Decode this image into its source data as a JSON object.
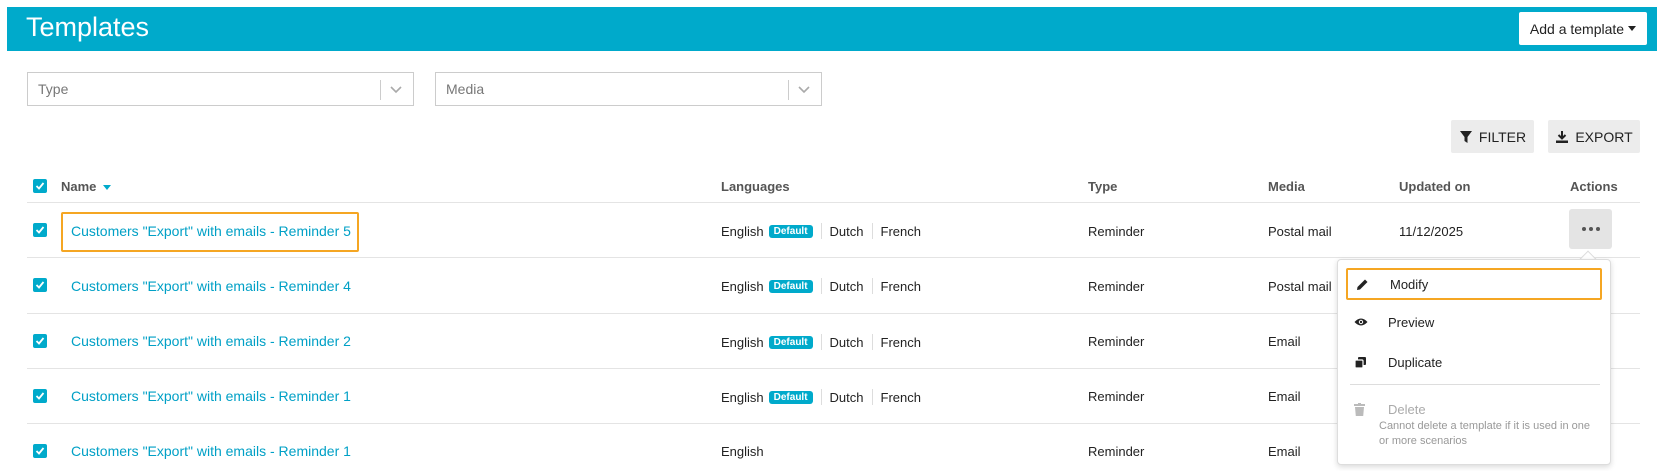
{
  "header": {
    "title": "Templates",
    "add_button": "Add a template"
  },
  "filters": {
    "type_placeholder": "Type",
    "media_placeholder": "Media"
  },
  "toolbar": {
    "filter_label": "FILTER",
    "export_label": "EXPORT"
  },
  "table": {
    "columns": {
      "name": "Name",
      "languages": "Languages",
      "type": "Type",
      "media": "Media",
      "updated_on": "Updated on",
      "actions": "Actions"
    },
    "default_badge": "Default",
    "rows": [
      {
        "name": "Customers \"Export\" with emails - Reminder 5",
        "lang1": "English",
        "lang2": "Dutch",
        "lang3": "French",
        "type": "Reminder",
        "media": "Postal mail",
        "updated": "11/12/2025"
      },
      {
        "name": "Customers \"Export\" with emails - Reminder 4",
        "lang1": "English",
        "lang2": "Dutch",
        "lang3": "French",
        "type": "Reminder",
        "media": "Postal mail",
        "updated": ""
      },
      {
        "name": "Customers \"Export\" with emails - Reminder 2",
        "lang1": "English",
        "lang2": "Dutch",
        "lang3": "French",
        "type": "Reminder",
        "media": "Email",
        "updated": ""
      },
      {
        "name": "Customers \"Export\" with emails - Reminder 1",
        "lang1": "English",
        "lang2": "Dutch",
        "lang3": "French",
        "type": "Reminder",
        "media": "Email",
        "updated": ""
      },
      {
        "name": "Customers \"Export\" with emails - Reminder 1",
        "lang1": "English",
        "lang2": "",
        "lang3": "",
        "type": "Reminder",
        "media": "Email",
        "updated": ""
      }
    ]
  },
  "menu": {
    "modify": "Modify",
    "preview": "Preview",
    "duplicate": "Duplicate",
    "delete": "Delete",
    "delete_note": "Cannot delete a template if it is used in one or more scenarios"
  },
  "colors": {
    "accent": "#00aacb",
    "highlight": "#f5a623"
  }
}
